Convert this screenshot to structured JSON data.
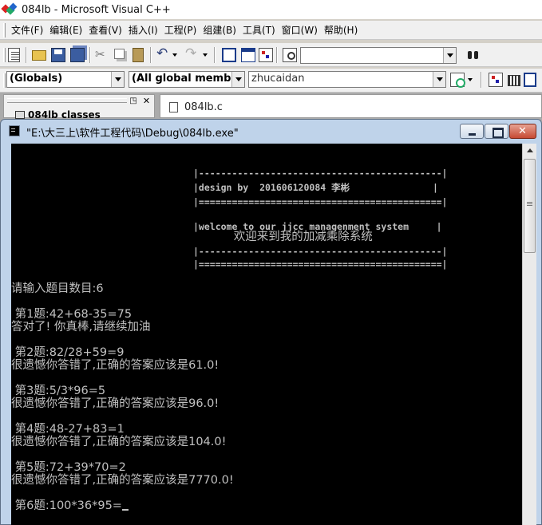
{
  "ide": {
    "title": "084lb - Microsoft Visual C++",
    "menu": [
      "文件(F)",
      "编辑(E)",
      "查看(V)",
      "插入(I)",
      "工程(P)",
      "组建(B)",
      "工具(T)",
      "窗口(W)",
      "帮助(H)"
    ],
    "combos": {
      "scope": "(Globals)",
      "members": "(All global members",
      "function": "zhucaidan",
      "find": ""
    },
    "workspace_tab": "084lb classes",
    "doc_tab": "084lb.c"
  },
  "console": {
    "title": "\"E:\\大三上\\软件工程代码\\Debug\\084lb.exe\"",
    "lines": [
      "|--------------------------------------------|",
      "|design by  201606120084 李彬               |",
      "|============================================|",
      "",
      "|welcome to our jjcc managenment system     |",
      "           欢迎来到我的加减乘除系统             ",
      "|--------------------------------------------|",
      "|============================================|",
      "请输入题目数目:6",
      "",
      " 第1题:42+68-35=75",
      "答对了! 你真棒,请继续加油",
      "",
      " 第2题:82/28+59=9",
      "很遗憾你答错了,正确的答案应该是61.0!",
      "",
      " 第3题:5/3*96=5",
      "很遗憾你答错了,正确的答案应该是96.0!",
      "",
      " 第4题:48-27+83=1",
      "很遗憾你答错了,正确的答案应该是104.0!",
      "",
      " 第5题:72+39*70=2",
      "很遗憾你答错了,正确的答案应该是7770.0!",
      "",
      " 第6题:100*36*95="
    ]
  }
}
